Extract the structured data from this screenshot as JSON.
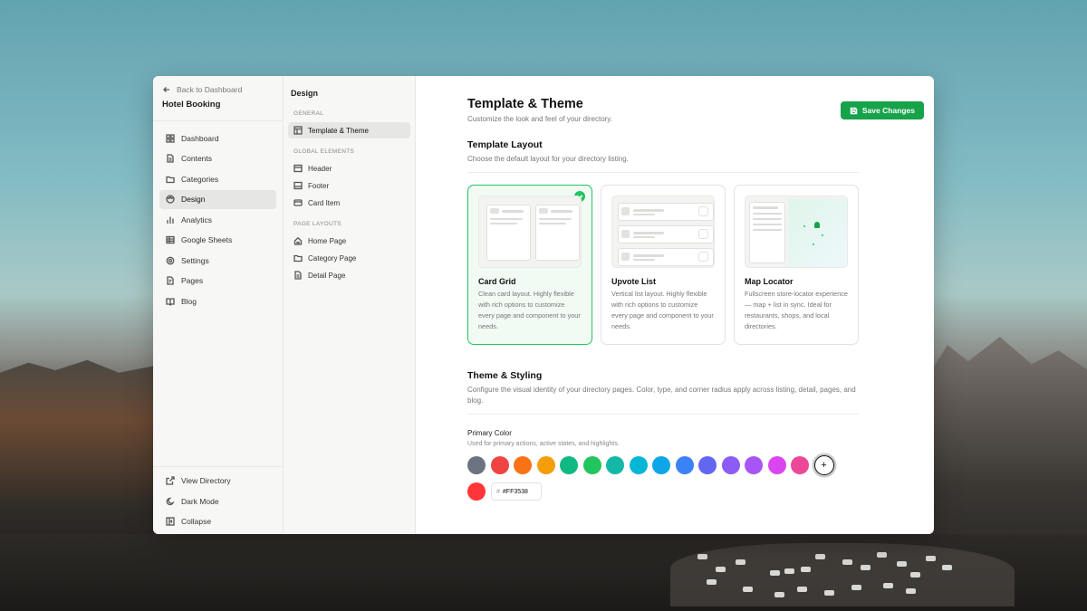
{
  "sidebar": {
    "back_label": "Back to Dashboard",
    "project_name": "Hotel Booking",
    "items": [
      {
        "label": "Dashboard",
        "icon": "dashboard-icon"
      },
      {
        "label": "Contents",
        "icon": "document-icon"
      },
      {
        "label": "Categories",
        "icon": "folder-icon"
      },
      {
        "label": "Design",
        "icon": "palette-icon",
        "active": true
      },
      {
        "label": "Analytics",
        "icon": "bar-chart-icon"
      },
      {
        "label": "Google Sheets",
        "icon": "table-icon"
      },
      {
        "label": "Settings",
        "icon": "gear-icon"
      },
      {
        "label": "Pages",
        "icon": "page-icon"
      },
      {
        "label": "Blog",
        "icon": "book-icon"
      }
    ],
    "bottom_items": [
      {
        "label": "View Directory",
        "icon": "external-link-icon"
      },
      {
        "label": "Dark Mode",
        "icon": "moon-icon"
      },
      {
        "label": "Collapse",
        "icon": "collapse-icon"
      }
    ]
  },
  "design_panel": {
    "title": "Design",
    "general_label": "GENERAL",
    "general_items": [
      {
        "label": "Template & Theme",
        "active": true
      }
    ],
    "global_label": "GLOBAL ELEMENTS",
    "global_items": [
      {
        "label": "Header"
      },
      {
        "label": "Footer"
      },
      {
        "label": "Card Item"
      }
    ],
    "layouts_label": "PAGE LAYOUTS",
    "layout_items": [
      {
        "label": "Home Page"
      },
      {
        "label": "Category Page"
      },
      {
        "label": "Detail Page"
      }
    ]
  },
  "main": {
    "title": "Template & Theme",
    "subtitle": "Customize the look and feel of your directory.",
    "save_label": "Save Changes",
    "layout_section": {
      "title": "Template Layout",
      "subtitle": "Choose the default layout for your directory listing."
    },
    "cards": [
      {
        "title": "Card Grid",
        "desc": "Clean card layout. Highly flexible with rich options to customize every page and component to your needs.",
        "selected": true
      },
      {
        "title": "Upvote List",
        "desc": "Vertical list layout. Highly flexible with rich options to customize every page and component to your needs.",
        "selected": false
      },
      {
        "title": "Map Locator",
        "desc": "Fullscreen store-locator experience — map + list in sync. Ideal for restaurants, shops, and local directories.",
        "selected": false
      }
    ],
    "theme_section": {
      "title": "Theme & Styling",
      "subtitle": "Configure the visual identity of your directory pages. Color, type, and corner radius apply across listing, detail, pages, and blog."
    },
    "primary_color": {
      "label": "Primary Color",
      "subtitle": "Used for primary actions, active states, and highlights.",
      "swatches": [
        "#6b7280",
        "#ef4444",
        "#f97316",
        "#f59e0b",
        "#10b981",
        "#22c55e",
        "#14b8a6",
        "#06b6d4",
        "#0ea5e9",
        "#3b82f6",
        "#6366f1",
        "#8b5cf6",
        "#a855f7",
        "#d946ef",
        "#ec4899"
      ],
      "add_symbol": "+",
      "current_swatch": "#ff3538",
      "hash": "#",
      "current_value": "#FF3538"
    }
  }
}
